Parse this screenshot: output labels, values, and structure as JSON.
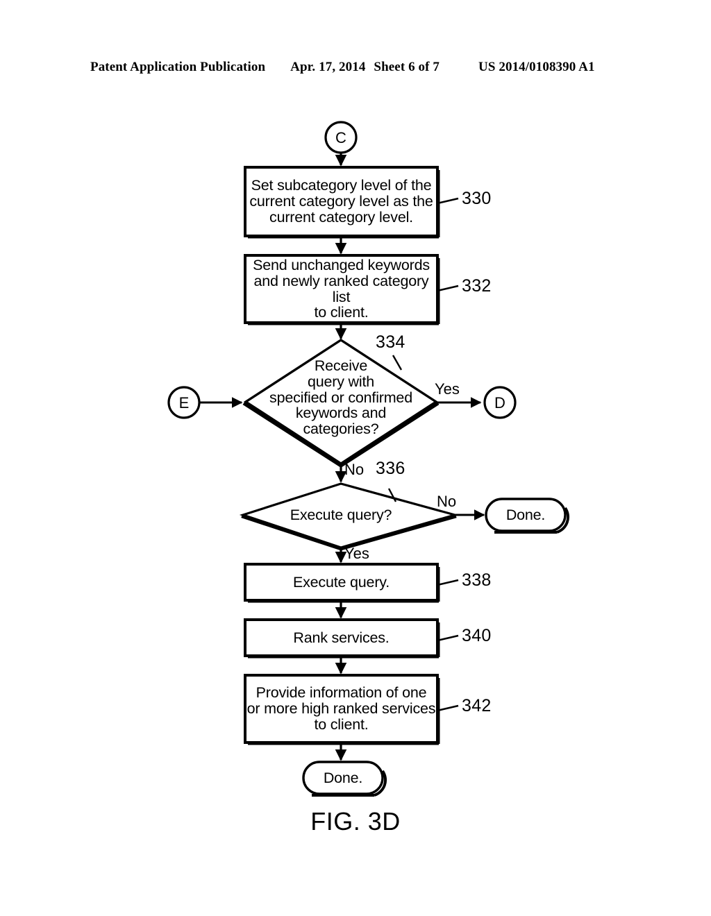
{
  "header": {
    "publication": "Patent Application Publication",
    "date": "Apr. 17, 2014",
    "sheet": "Sheet 6 of 7",
    "patent_number": "US 2014/0108390 A1"
  },
  "figure": {
    "caption": "FIG. 3D",
    "connectors": {
      "top_in": "C",
      "left_in": "E",
      "right_out": "D"
    },
    "nodes": [
      {
        "id": "330",
        "type": "process",
        "text": "Set subcategory level of the\ncurrent category level as the\ncurrent category level.",
        "ref": "330"
      },
      {
        "id": "332",
        "type": "process",
        "text": "Send unchanged keywords\nand newly ranked category list\nto client.",
        "ref": "332"
      },
      {
        "id": "334",
        "type": "decision",
        "text": "Receive\nquery with\nspecified or confirmed\nkeywords and\ncategories?",
        "ref": "334"
      },
      {
        "id": "336",
        "type": "decision",
        "text": "Execute query?",
        "ref": "336"
      },
      {
        "id": "338",
        "type": "process",
        "text": "Execute query.",
        "ref": "338"
      },
      {
        "id": "340",
        "type": "process",
        "text": "Rank services.",
        "ref": "340"
      },
      {
        "id": "342",
        "type": "process",
        "text": "Provide information of one\nor more high ranked services\nto client.",
        "ref": "342"
      },
      {
        "id": "done-right",
        "type": "terminal",
        "text": "Done."
      },
      {
        "id": "done-bottom",
        "type": "terminal",
        "text": "Done."
      }
    ],
    "edge_labels": {
      "d334_yes": "Yes",
      "d334_no": "No",
      "d336_no": "No",
      "d336_yes": "Yes"
    },
    "colors": {
      "stroke": "#000000",
      "fill": "#ffffff"
    }
  }
}
